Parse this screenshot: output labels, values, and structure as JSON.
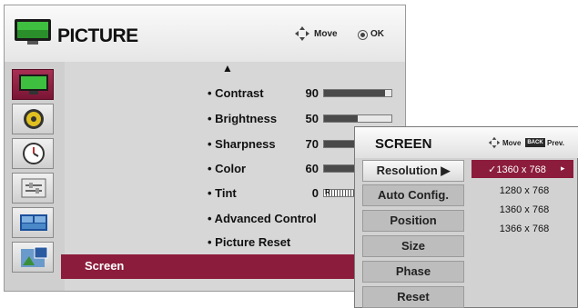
{
  "picture_menu": {
    "title": "PICTURE",
    "header_move_label": "Move",
    "header_ok_label": "OK",
    "up_arrow": "▲",
    "items": [
      {
        "label": "• Contrast",
        "value": "90",
        "level": 90
      },
      {
        "label": "• Brightness",
        "value": "50",
        "level": 50
      },
      {
        "label": "• Sharpness",
        "value": "70",
        "level": 70
      },
      {
        "label": "• Color",
        "value": "60",
        "level": 60
      },
      {
        "label": "• Tint",
        "value": "0",
        "level": 0,
        "marker_left": "R"
      },
      {
        "label": "• Advanced Control"
      },
      {
        "label": "• Picture Reset"
      }
    ],
    "screen_label": "Screen",
    "sidebar_icons": [
      "picture-icon",
      "audio-icon",
      "time-icon",
      "option-icon",
      "screen-icon",
      "pip-icon"
    ]
  },
  "screen_menu": {
    "title": "SCREEN",
    "move_label": "Move",
    "back_label": "BACK",
    "prev_label": "Prev.",
    "items": [
      "Resolution ▶",
      "Auto Config.",
      "Position",
      "Size",
      "Phase",
      "Reset"
    ],
    "resolution_options": [
      "✓1360 x 768",
      "1280 x 768",
      "1360 x 768",
      "1366 x 768"
    ],
    "selected_arrow": "▸"
  },
  "colors": {
    "accent": "#8c1c3c",
    "panel": "#d7d7d7"
  }
}
